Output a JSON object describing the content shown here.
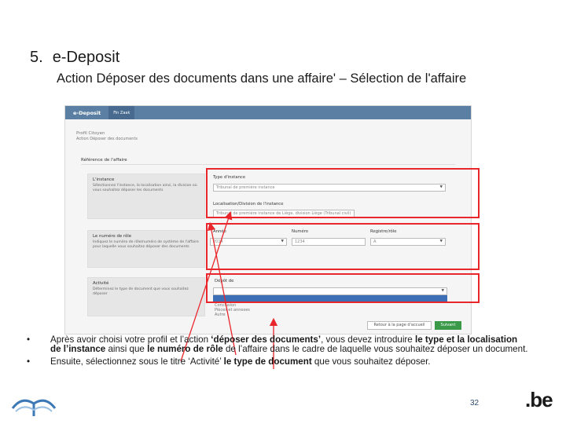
{
  "slide": {
    "number": "5.",
    "title": "e-Deposit",
    "subtitle": "Action Déposer des documents dans une affaire' – Sélection de l'affaire",
    "page_number": "32",
    "logo_text": ".be"
  },
  "screenshot": {
    "brand": "e-Deposit",
    "nav_tab": "Fin Zaak",
    "profile_line1": "Profil Citoyen",
    "profile_line2": "Action Déposer des documents",
    "section": "Référence de l'affaire",
    "panels": {
      "instance_title": "L'instance",
      "instance_desc": "Sélectionnez l'instance, la localisation ainsi, la division où vous souhaitez déposer les documents",
      "role_title": "Le numéro de rôle",
      "role_desc": "Indiquez le numéro de rôle/numéro de système de l'affaire pour laquelle vous souhaitez déposer des documents",
      "activity_title": "Activité",
      "activity_desc": "Déterminez le type de document que vous souhaitez déposer"
    },
    "fields": {
      "instance_type_label": "Type d'instance",
      "instance_type_value": "Tribunal de première instance",
      "location_label": "Localisation/Division de l'instance",
      "location_value": "Tribunal de première instance de Liège, division Liège (Tribunal civil)",
      "year_label": "Année",
      "year_value": "2014",
      "number_label": "Numéro",
      "number_value": "1234",
      "registry_label": "Registre/rôle",
      "registry_value": "A",
      "document_label": "Dépôt de",
      "document_value": ""
    },
    "dropdown_options": [
      "Conclusion",
      "Pièces et annexes",
      "Autre"
    ],
    "buttons": {
      "back": "Retour à la page d'accueil",
      "next": "Suivant"
    }
  },
  "bullets": [
    {
      "segments": [
        {
          "text": "Après avoir choisi votre profil et l’action ",
          "bold": false
        },
        {
          "text": "‘déposer des documents’",
          "bold": true
        },
        {
          "text": ", vous devez introduire ",
          "bold": false
        },
        {
          "text": "le type et la localisation de l’instance",
          "bold": true
        },
        {
          "text": " ainsi que ",
          "bold": false
        },
        {
          "text": "le numéro de rôle",
          "bold": true
        },
        {
          "text": " de l’affaire dans le cadre de laquelle vous souhaitez déposer un document.",
          "bold": false
        }
      ]
    },
    {
      "segments": [
        {
          "text": "Ensuite, sélectionnez sous le titre ‘Activité’ ",
          "bold": false
        },
        {
          "text": "le type de document",
          "bold": true
        },
        {
          "text": " que vous souhaitez déposer.",
          "bold": false
        }
      ]
    }
  ],
  "colors": {
    "highlight_red": "#e8262c",
    "topbar_blue": "#5b7fa3",
    "next_green": "#3a9a4a"
  }
}
